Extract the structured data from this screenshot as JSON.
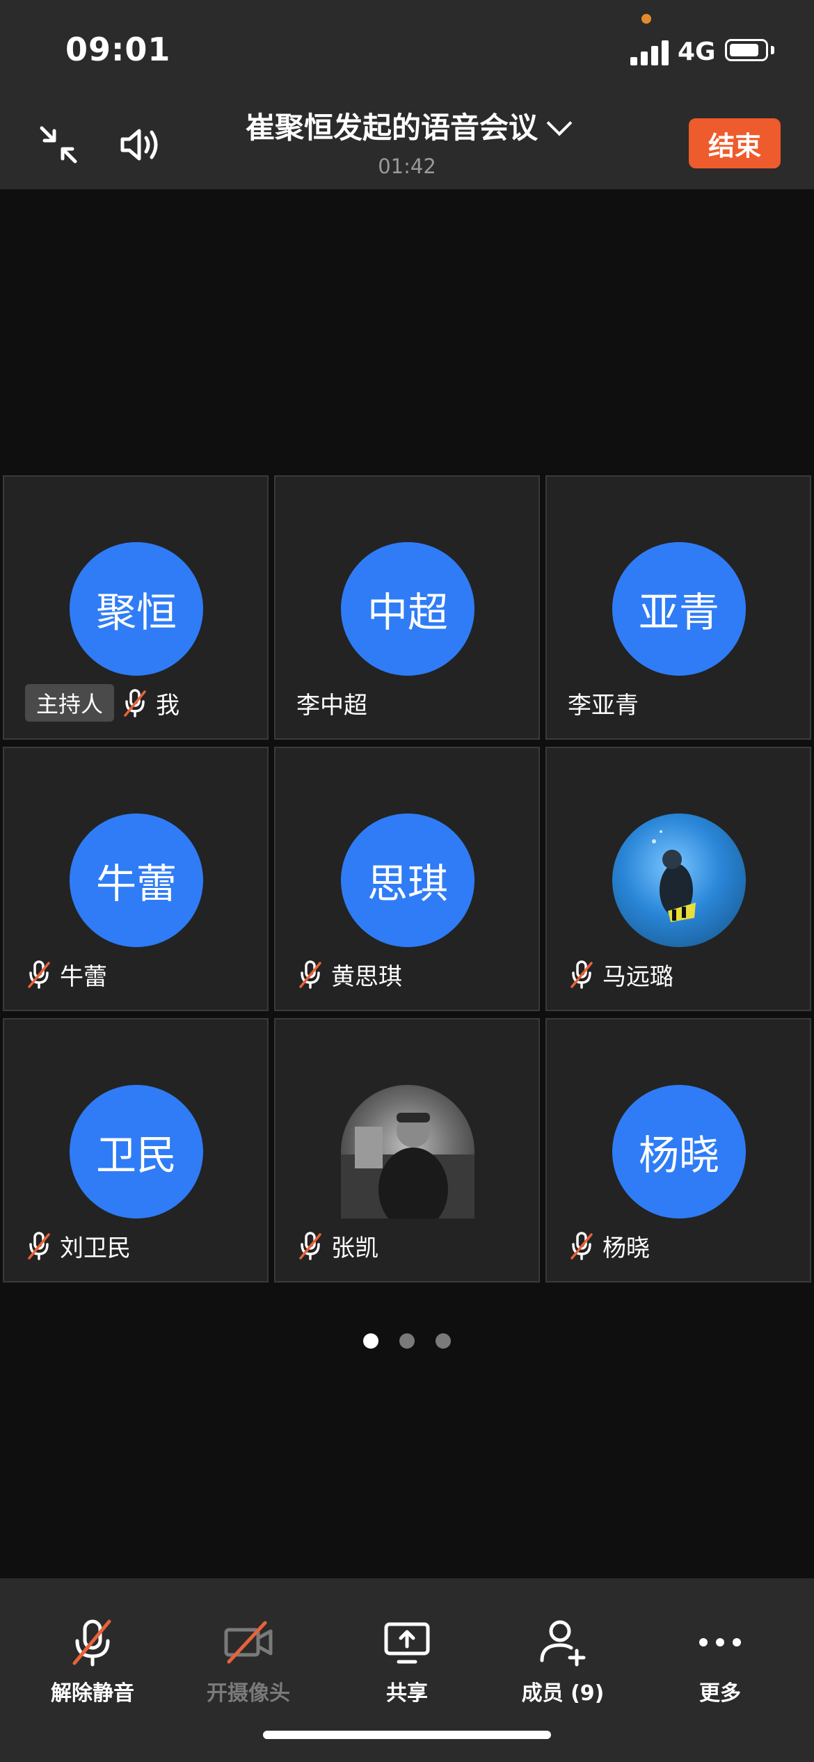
{
  "status_bar": {
    "time": "09:01",
    "network": "4G",
    "battery_fraction": 0.85
  },
  "header": {
    "title": "崔聚恒发起的语音会议",
    "duration": "01:42",
    "end_label": "结束",
    "icons": [
      "minimize-arrows-icon",
      "speaker-icon",
      "chevron-down-icon"
    ]
  },
  "participants": [
    {
      "avatar_text": "聚恒",
      "name": "我",
      "host_badge": "主持人",
      "muted": true
    },
    {
      "avatar_text": "中超",
      "name": "李中超",
      "muted": false
    },
    {
      "avatar_text": "亚青",
      "name": "李亚青",
      "muted": false
    },
    {
      "avatar_text": "牛蕾",
      "name": "牛蕾",
      "muted": true
    },
    {
      "avatar_text": "思琪",
      "name": "黄思琪",
      "muted": true
    },
    {
      "avatar_text": "",
      "name": "马远璐",
      "muted": true,
      "avatar_image": "diver-photo"
    },
    {
      "avatar_text": "卫民",
      "name": "刘卫民",
      "muted": true
    },
    {
      "avatar_text": "",
      "name": "张凯",
      "muted": true,
      "avatar_image": "bw-portrait-photo"
    },
    {
      "avatar_text": "杨晓",
      "name": "杨晓",
      "muted": true
    }
  ],
  "pagination": {
    "pages": 3,
    "current": 1
  },
  "toolbar": {
    "unmute_label": "解除静音",
    "camera_label": "开摄像头",
    "share_label": "共享",
    "members_label": "成员 (9)",
    "more_label": "更多"
  },
  "colors": {
    "avatar_blue": "#2f7cf6",
    "end_red": "#ee5b2c",
    "mute_slash": "#e8623a",
    "bar_bg": "#2b2b2b"
  }
}
